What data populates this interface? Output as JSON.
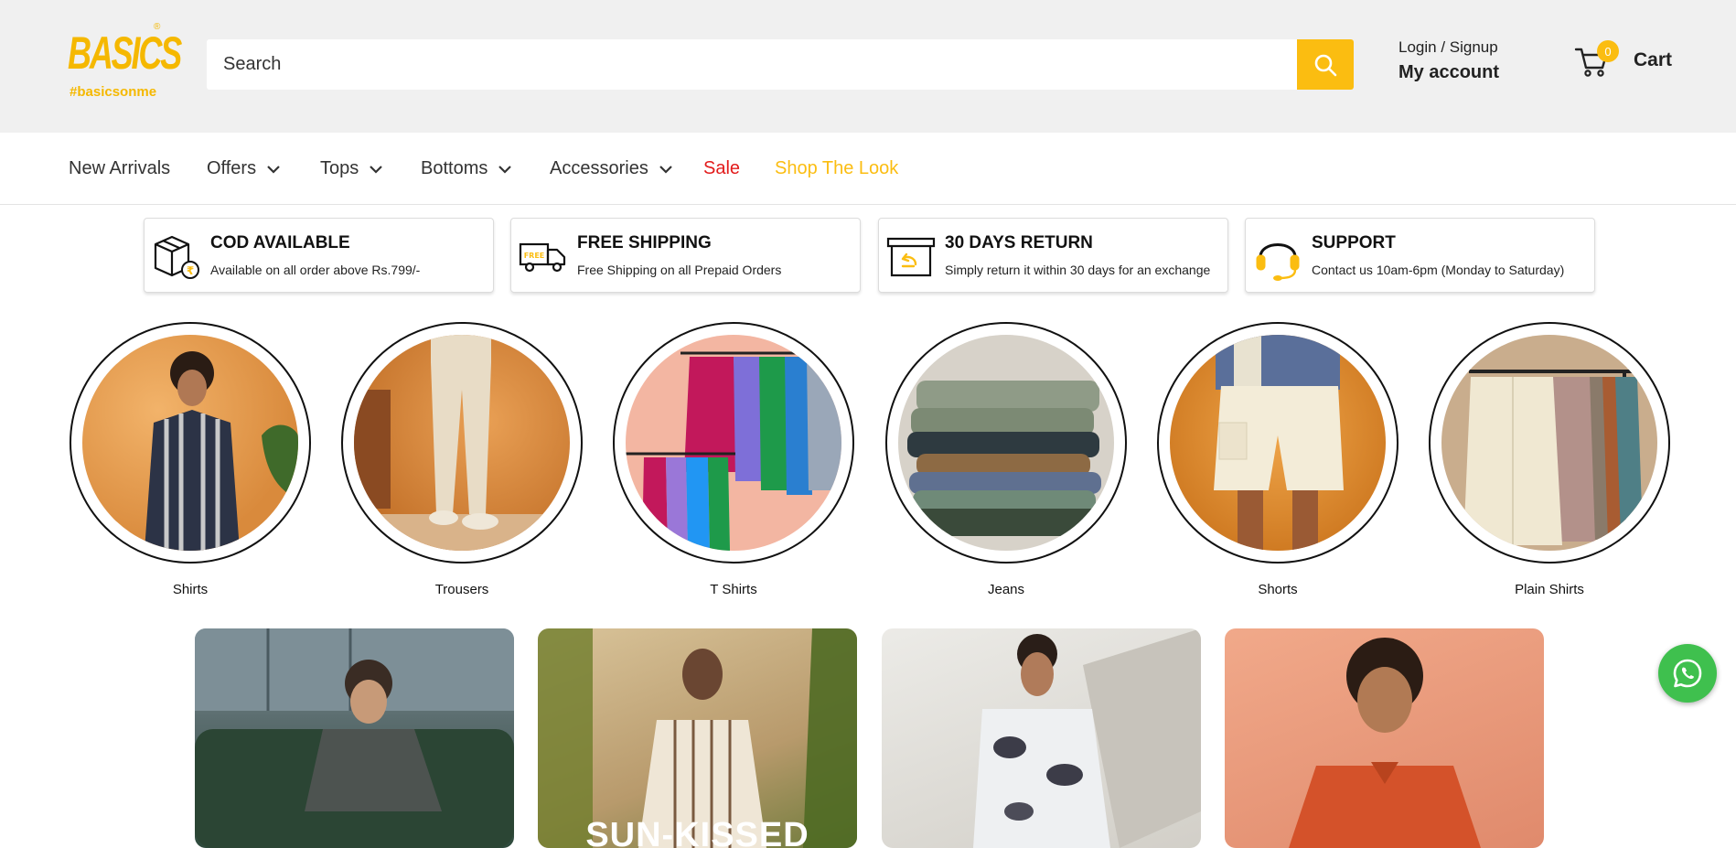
{
  "brand": {
    "logo_text": "BASICS",
    "reg_mark": "®",
    "tagline": "#basicsonme",
    "accent": "#fbbd11"
  },
  "search": {
    "placeholder": "Search"
  },
  "account": {
    "login": "Login / Signup",
    "my_account": "My account"
  },
  "cart": {
    "count": "0",
    "label": "Cart"
  },
  "nav": {
    "items": [
      {
        "label": "New Arrivals"
      },
      {
        "label": "Offers"
      },
      {
        "label": "Tops"
      },
      {
        "label": "Bottoms"
      },
      {
        "label": "Accessories"
      },
      {
        "label": "Sale",
        "color": "#e21b1b"
      },
      {
        "label": "Shop The Look",
        "color": "#fbbd11"
      }
    ]
  },
  "features": [
    {
      "title": "COD AVAILABLE",
      "subtitle": "Available on all order above Rs.799/-",
      "icon": "cod-box-icon"
    },
    {
      "title": "FREE SHIPPING",
      "subtitle": "Free Shipping on all Prepaid Orders",
      "icon": "delivery-truck-icon",
      "icon_text": "FREE"
    },
    {
      "title": "30 DAYS RETURN",
      "subtitle": "Simply return it within 30 days for an exchange",
      "icon": "return-box-icon"
    },
    {
      "title": "SUPPORT",
      "subtitle": "Contact us 10am-6pm (Monday to Saturday)",
      "icon": "headset-icon"
    }
  ],
  "categories": [
    {
      "label": "Shirts"
    },
    {
      "label": "Trousers"
    },
    {
      "label": "T Shirts"
    },
    {
      "label": "Jeans"
    },
    {
      "label": "Shorts"
    },
    {
      "label": "Plain Shirts"
    }
  ],
  "banners": [
    {
      "text": ""
    },
    {
      "text": "SUN-KISSED"
    },
    {
      "text": ""
    },
    {
      "text": ""
    }
  ]
}
